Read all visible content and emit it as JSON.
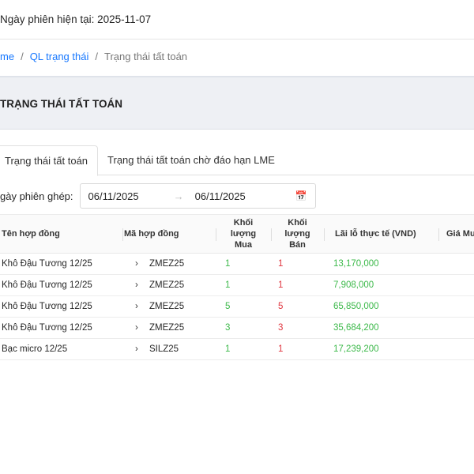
{
  "header": {
    "session_date": "Ngày phiên hiện tại: 2025-11-07"
  },
  "breadcrumb": [
    "me",
    "QL trạng thái",
    "Trạng thái tất toán"
  ],
  "page_title": "TRẠNG THÁI TẤT TOÁN",
  "tabs": [
    "Trạng thái tất toán",
    "Trạng thái tất toán chờ đáo hạn LME"
  ],
  "filter": {
    "label": "gày phiên ghép:",
    "from": "06/11/2025",
    "to": "06/11/2025",
    "separator": "→"
  },
  "table": {
    "columns": [
      "Tên hợp đồng",
      "Mã hợp đồng",
      "Khối lượng Mua",
      "Khối lượng Bán",
      "Lãi lỗ thực tế (VND)",
      "Giá Mu"
    ],
    "rows": [
      {
        "name": "Khô Đậu Tương 12/25",
        "code": "ZMEZ25",
        "buy": "1",
        "sell": "1",
        "pnl": "13,170,000"
      },
      {
        "name": "Khô Đậu Tương 12/25",
        "code": "ZMEZ25",
        "buy": "1",
        "sell": "1",
        "pnl": "7,908,000"
      },
      {
        "name": "Khô Đậu Tương 12/25",
        "code": "ZMEZ25",
        "buy": "5",
        "sell": "5",
        "pnl": "65,850,000"
      },
      {
        "name": "Khô Đậu Tương 12/25",
        "code": "ZMEZ25",
        "buy": "3",
        "sell": "3",
        "pnl": "35,684,200"
      },
      {
        "name": "Bạc micro 12/25",
        "code": "SILZ25",
        "buy": "1",
        "sell": "1",
        "pnl": "17,239,200"
      }
    ]
  },
  "colors": {
    "buy": "#3cb94a",
    "sell": "#e0343e",
    "link": "#1677ff"
  }
}
